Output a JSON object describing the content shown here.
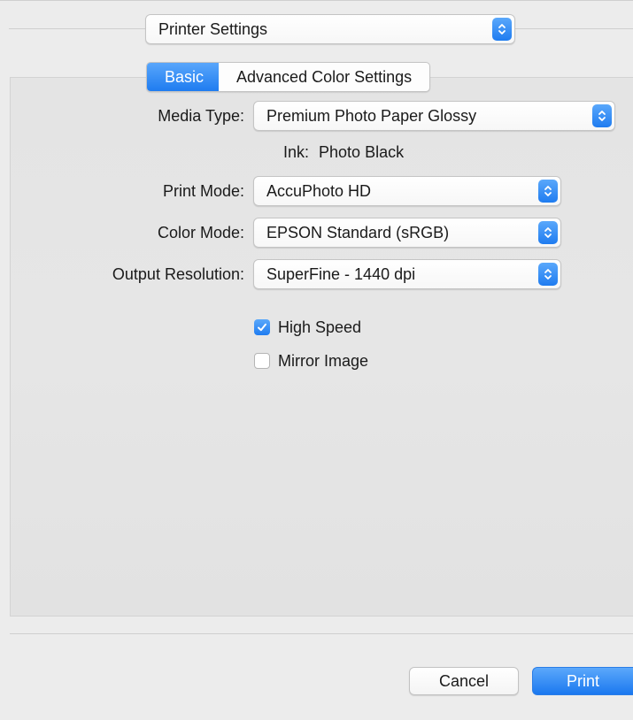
{
  "section_popup": {
    "value": "Printer Settings"
  },
  "tabs": [
    {
      "label": "Basic",
      "selected": true
    },
    {
      "label": "Advanced Color Settings",
      "selected": false
    }
  ],
  "fields": {
    "media_type": {
      "label": "Media Type:",
      "value": "Premium Photo Paper Glossy"
    },
    "ink": {
      "label": "Ink:",
      "value": "Photo Black"
    },
    "print_mode": {
      "label": "Print Mode:",
      "value": "AccuPhoto HD"
    },
    "color_mode": {
      "label": "Color Mode:",
      "value": "EPSON Standard (sRGB)"
    },
    "output_resolution": {
      "label": "Output Resolution:",
      "value": "SuperFine - 1440 dpi"
    }
  },
  "options": {
    "high_speed": {
      "label": "High Speed",
      "checked": true
    },
    "mirror_image": {
      "label": "Mirror Image",
      "checked": false
    }
  },
  "buttons": {
    "cancel": "Cancel",
    "print": "Print"
  },
  "colors": {
    "accent": "#1f7cf0",
    "window_bg": "#ececec",
    "panel_bg": "#e4e4e4"
  },
  "icons": {
    "popup_arrows": "up-down-chevron-icon",
    "check": "checkmark-icon"
  }
}
